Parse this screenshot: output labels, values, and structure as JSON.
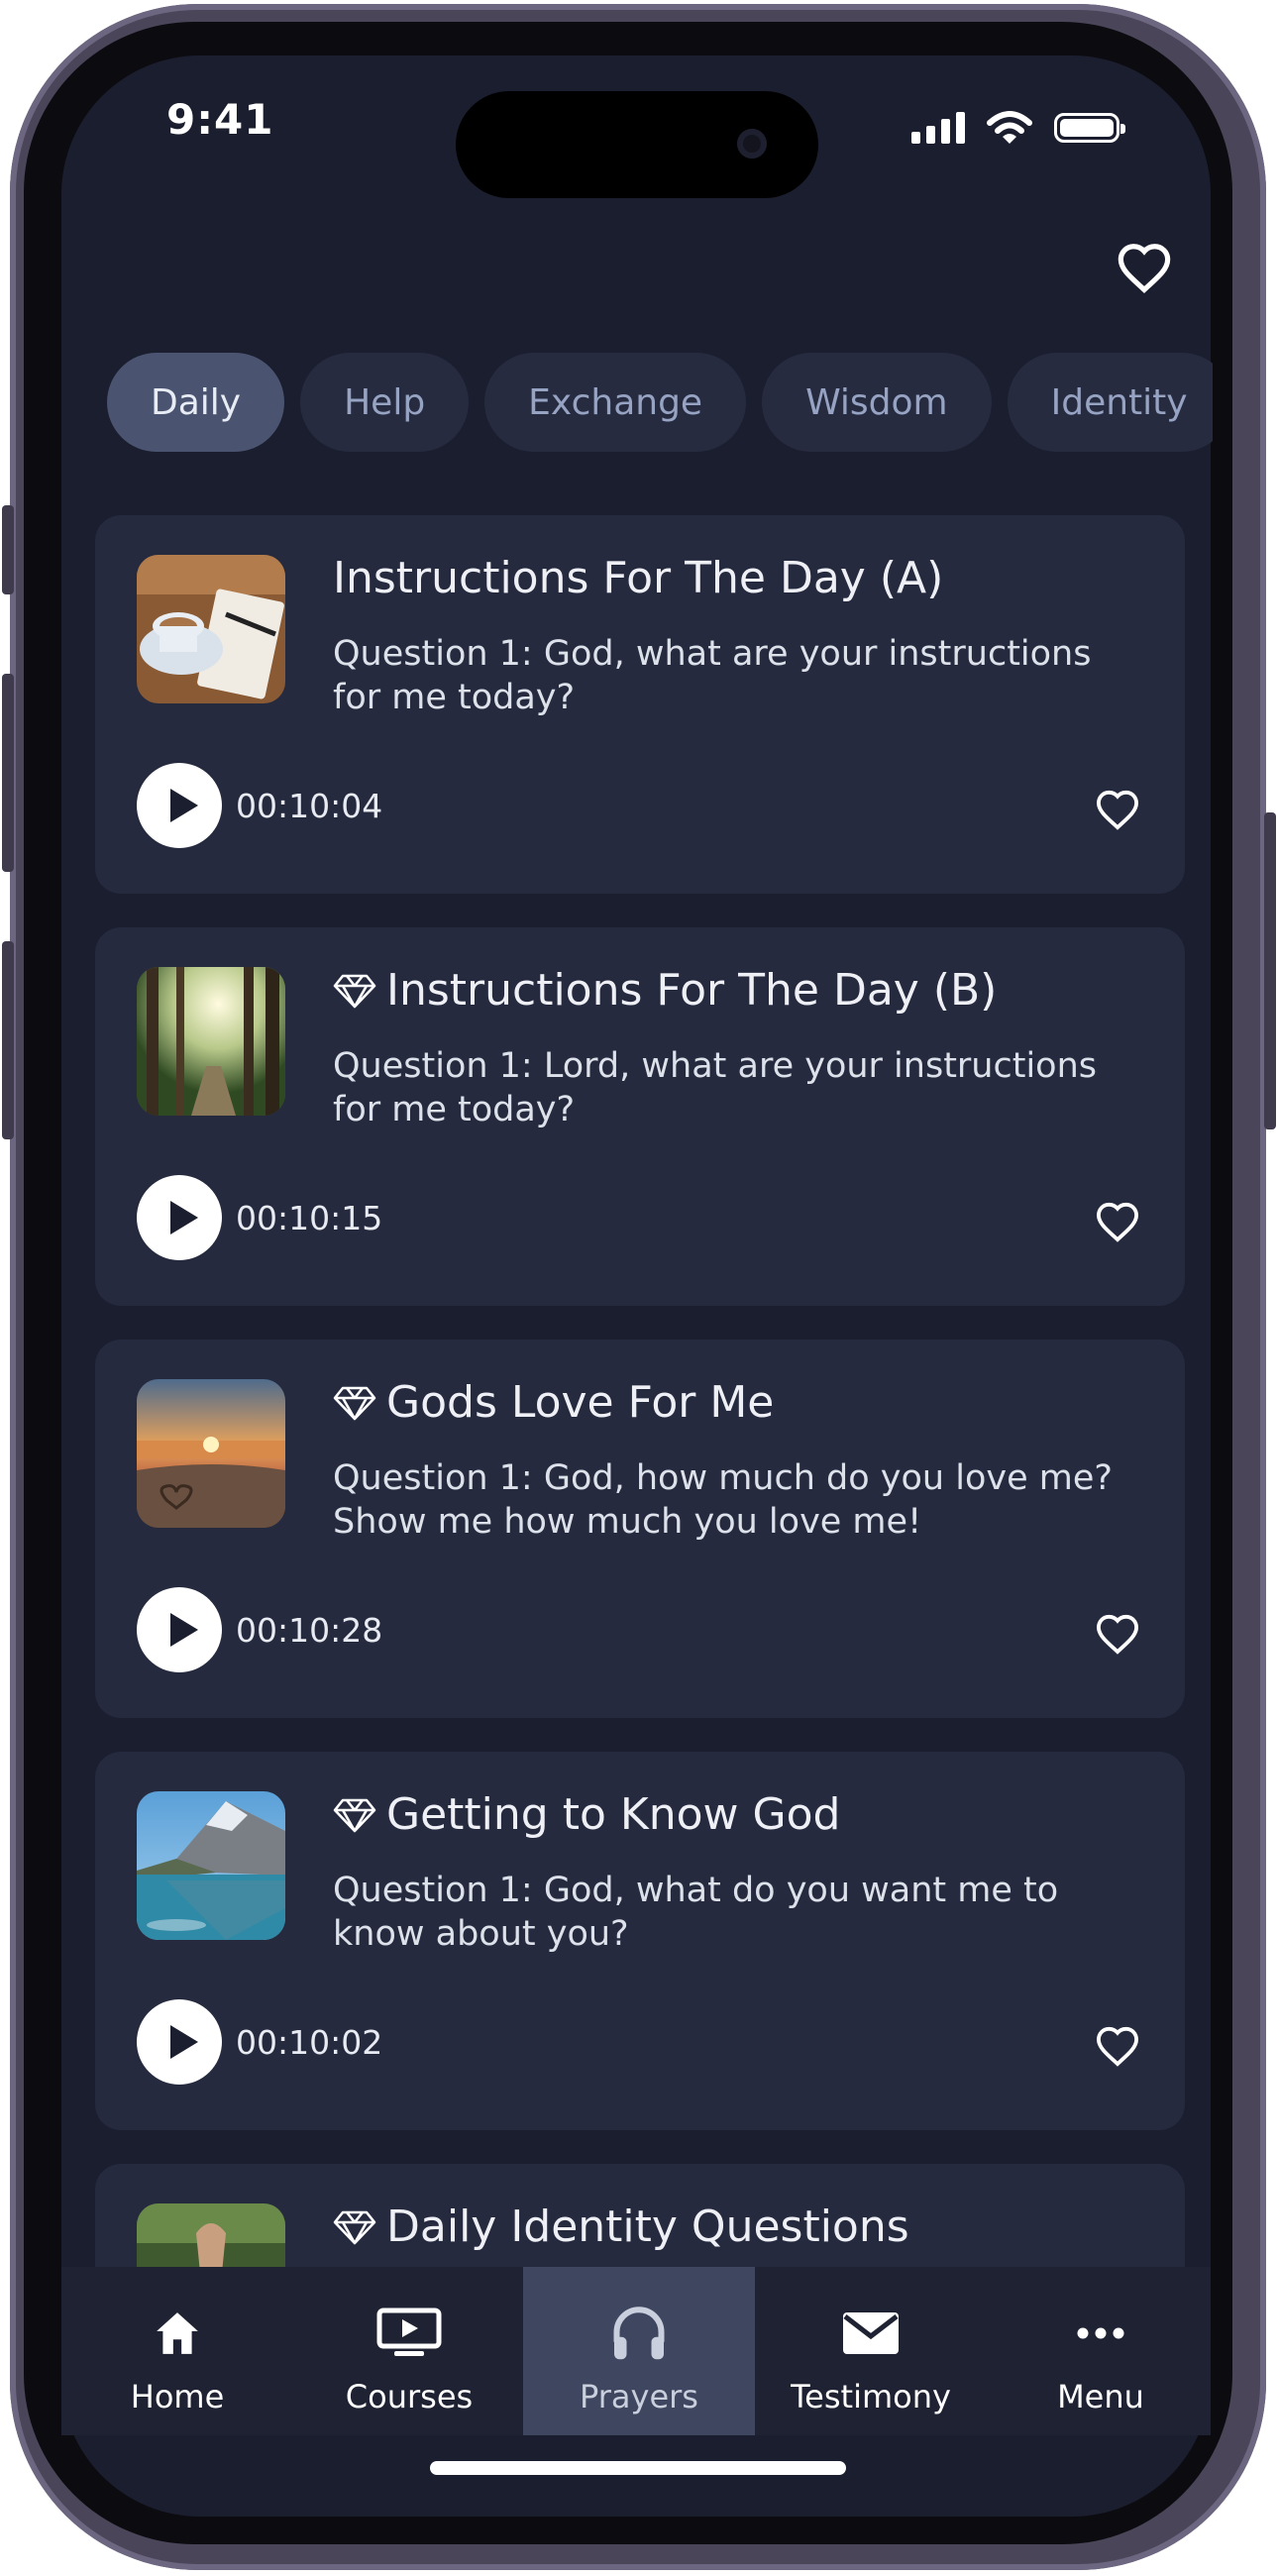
{
  "status_bar": {
    "time": "9:41"
  },
  "categories": {
    "items": [
      {
        "label": "Daily",
        "active": true
      },
      {
        "label": "Help",
        "active": false
      },
      {
        "label": "Exchange",
        "active": false
      },
      {
        "label": "Wisdom",
        "active": false
      },
      {
        "label": "Identity",
        "active": false
      }
    ]
  },
  "prayers": [
    {
      "title": "Instructions For The Day (A)",
      "premium": false,
      "description": "Question 1: God, what are your instructions for me today?",
      "duration": "00:10:04",
      "thumbnail": "coffee-notebook"
    },
    {
      "title": "Instructions For The Day (B)",
      "premium": true,
      "description": "Question 1: Lord, what are your instructions for me today?",
      "duration": "00:10:15",
      "thumbnail": "forest-sunlight"
    },
    {
      "title": "Gods Love For Me",
      "premium": true,
      "description": "Question 1: God, how much do you love me? Show me how much you love me!",
      "duration": "00:10:28",
      "thumbnail": "beach-sunset-heart"
    },
    {
      "title": "Getting to Know God",
      "premium": true,
      "description": "Question 1: God, what do you want me to know about you?",
      "duration": "00:10:02",
      "thumbnail": "mountain-lake"
    },
    {
      "title": "Daily Identity Questions",
      "premium": true,
      "description": "",
      "duration": "",
      "thumbnail": "green-hand"
    }
  ],
  "tabbar": {
    "items": [
      {
        "label": "Home",
        "icon": "home-icon",
        "active": false
      },
      {
        "label": "Courses",
        "icon": "courses-icon",
        "active": false
      },
      {
        "label": "Prayers",
        "icon": "headphones-icon",
        "active": true
      },
      {
        "label": "Testimony",
        "icon": "mail-icon",
        "active": false
      },
      {
        "label": "Menu",
        "icon": "more-icon",
        "active": false
      }
    ]
  },
  "colors": {
    "background": "#1b1e2e",
    "card": "#252a3f",
    "chip": "#262b40",
    "chip_active": "#4a5470",
    "tab_active": "#3f4660"
  }
}
